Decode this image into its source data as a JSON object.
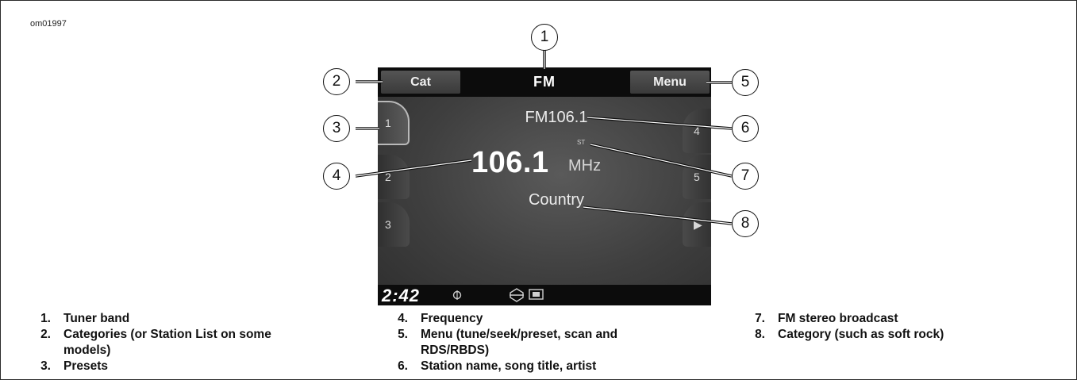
{
  "figure_id": "om01997",
  "screen": {
    "band": "FM",
    "cat_label": "Cat",
    "menu_label": "Menu",
    "station_name": "FM106.1",
    "stereo_indicator": "ST",
    "frequency": "106.1",
    "frequency_unit": "MHz",
    "category": "Country",
    "clock": "2:42",
    "presets_left": [
      "1",
      "2",
      "3"
    ],
    "presets_right": [
      "4",
      "5",
      "▶"
    ],
    "bottom_icons": [
      "tuner-dial-icon",
      "harley-logo-icon",
      "battery-icon"
    ]
  },
  "callouts": [
    "1",
    "2",
    "3",
    "4",
    "5",
    "6",
    "7",
    "8"
  ],
  "legend": [
    {
      "num": "1.",
      "text": "Tuner band"
    },
    {
      "num": "2.",
      "text": "Categories (or Station List on some models)"
    },
    {
      "num": "3.",
      "text": "Presets"
    },
    {
      "num": "4.",
      "text": "Frequency"
    },
    {
      "num": "5.",
      "text": "Menu (tune/seek/preset, scan and RDS/RBDS)"
    },
    {
      "num": "6.",
      "text": "Station name, song title, artist"
    },
    {
      "num": "7.",
      "text": "FM stereo broadcast"
    },
    {
      "num": "8.",
      "text": "Category (such as soft rock)"
    }
  ]
}
